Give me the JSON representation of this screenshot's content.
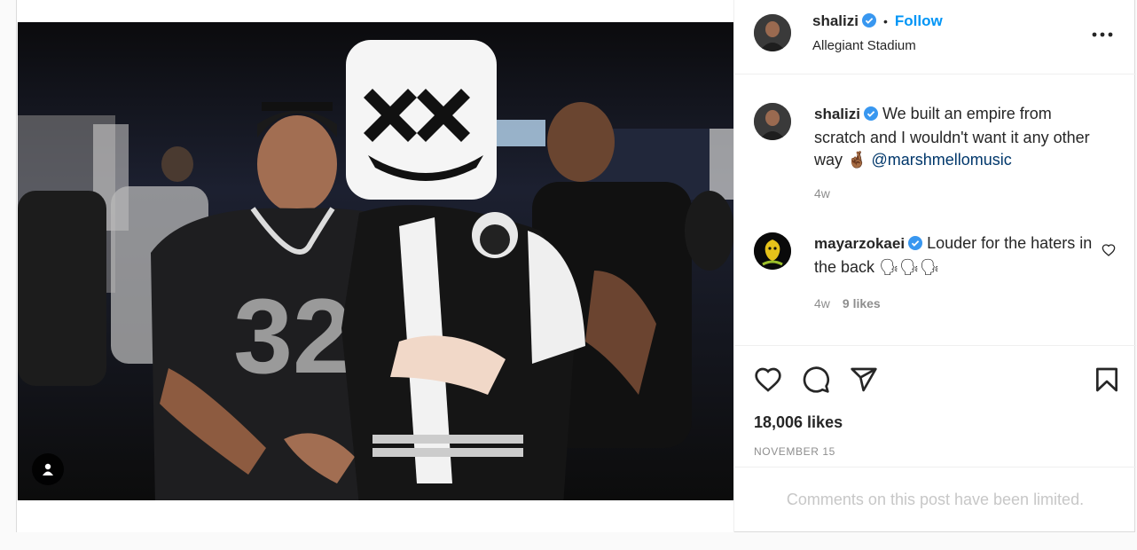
{
  "post": {
    "author": {
      "username": "shalizi",
      "follow_label": "Follow",
      "location": "Allegiant Stadium"
    },
    "photo_alt": "",
    "caption": {
      "username": "shalizi",
      "text": "We built an empire from scratch and I wouldn't want it any other way 🤞🏾 ",
      "mention": "@marshmellomusic",
      "age": "4w"
    },
    "comments": [
      {
        "username": "mayarzokaei",
        "text": "Louder for the haters in the back 🗣🗣🗣",
        "age": "4w",
        "likes": "9 likes"
      }
    ],
    "likes": "18,006 likes",
    "date": "NOVEMBER 15",
    "limited_notice": "Comments on this post have been limited."
  },
  "colors": {
    "follow": "#0095f6",
    "verified": "#3897f0",
    "mention": "#00376b",
    "muted": "#8e8e8e"
  },
  "icons": [
    "user-tag-icon",
    "verified-badge-icon",
    "more-options-icon",
    "like-heart-icon",
    "comment-icon",
    "share-icon",
    "save-bookmark-icon",
    "comment-like-icon"
  ]
}
